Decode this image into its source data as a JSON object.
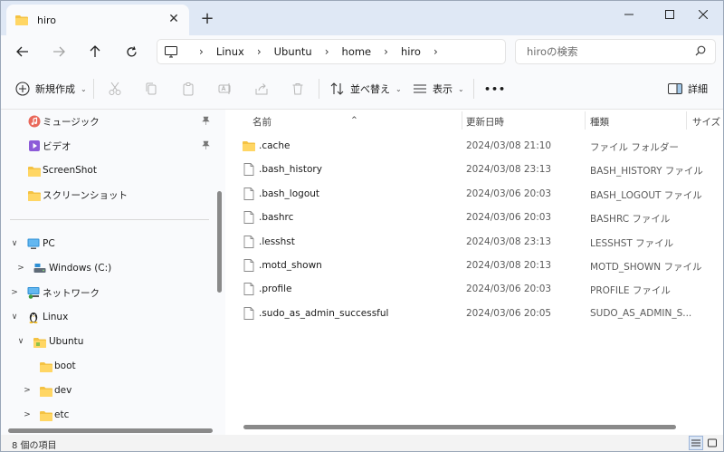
{
  "tab": {
    "title": "hiro",
    "close_glyph": "✕",
    "new_tab_glyph": "+"
  },
  "navigation": {
    "breadcrumbs": [
      "Linux",
      "Ubuntu",
      "home",
      "hiro"
    ],
    "search_placeholder": "hiroの検索"
  },
  "commands": {
    "new": "新規作成",
    "sort": "並べ替え",
    "view": "表示",
    "more": "•••",
    "details": "詳細"
  },
  "sidebar": {
    "pinned": [
      {
        "label": "ミュージック",
        "icon": "music-icon",
        "pinned": true
      },
      {
        "label": "ビデオ",
        "icon": "video-icon",
        "pinned": true
      },
      {
        "label": "ScreenShot",
        "icon": "folder-icon",
        "pinned": false
      },
      {
        "label": "スクリーンショット",
        "icon": "folder-icon",
        "pinned": false
      }
    ],
    "tree": [
      {
        "label": "PC",
        "icon": "pc-icon",
        "expander": "∨"
      },
      {
        "label": "Windows (C:)",
        "icon": "drive-icon",
        "expander": ">"
      },
      {
        "label": "ネットワーク",
        "icon": "network-icon",
        "expander": ">"
      },
      {
        "label": "Linux",
        "icon": "linux-icon",
        "expander": "∨"
      },
      {
        "label": "Ubuntu",
        "icon": "folder-icon",
        "expander": "∨"
      },
      {
        "label": "boot",
        "icon": "folder-icon",
        "expander": ""
      },
      {
        "label": "dev",
        "icon": "folder-icon",
        "expander": ">"
      },
      {
        "label": "etc",
        "icon": "folder-icon",
        "expander": ">"
      }
    ],
    "pin_glyph": "📌"
  },
  "columns": {
    "name": "名前",
    "modified": "更新日時",
    "type": "種類",
    "size": "サイズ"
  },
  "files": [
    {
      "name": ".cache",
      "modified": "2024/03/08 21:10",
      "type": "ファイル フォルダー",
      "is_folder": true
    },
    {
      "name": ".bash_history",
      "modified": "2024/03/08 23:13",
      "type": "BASH_HISTORY ファイル",
      "is_folder": false
    },
    {
      "name": ".bash_logout",
      "modified": "2024/03/06 20:03",
      "type": "BASH_LOGOUT ファイル",
      "is_folder": false
    },
    {
      "name": ".bashrc",
      "modified": "2024/03/06 20:03",
      "type": "BASHRC ファイル",
      "is_folder": false
    },
    {
      "name": ".lesshst",
      "modified": "2024/03/08 23:13",
      "type": "LESSHST ファイル",
      "is_folder": false
    },
    {
      "name": ".motd_shown",
      "modified": "2024/03/08 20:13",
      "type": "MOTD_SHOWN ファイル",
      "is_folder": false
    },
    {
      "name": ".profile",
      "modified": "2024/03/06 20:03",
      "type": "PROFILE ファイル",
      "is_folder": false
    },
    {
      "name": ".sudo_as_admin_successful",
      "modified": "2024/03/06 20:05",
      "type": "SUDO_AS_ADMIN_S...",
      "is_folder": false
    }
  ],
  "status": {
    "item_count": "8 個の項目"
  },
  "colors": {
    "folder": "#f4c243",
    "accent": "#0067c0",
    "titlebar": "#dfe8f5"
  }
}
